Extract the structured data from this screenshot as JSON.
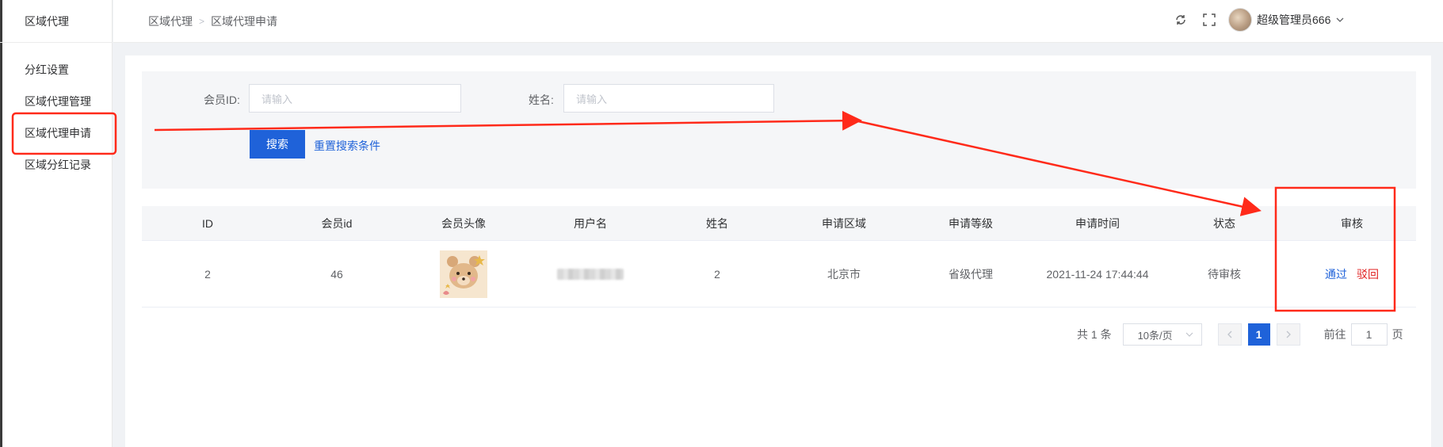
{
  "sidebar": {
    "title": "区域代理",
    "items": [
      {
        "label": "分红设置"
      },
      {
        "label": "区域代理管理"
      },
      {
        "label": "区域代理申请"
      },
      {
        "label": "区域分红记录"
      }
    ]
  },
  "header": {
    "breadcrumb": [
      "区域代理",
      "区域代理申请"
    ],
    "user_name": "超级管理员666"
  },
  "search": {
    "member_id_label": "会员ID:",
    "member_id_placeholder": "请输入",
    "name_label": "姓名:",
    "name_placeholder": "请输入",
    "search_button": "搜索",
    "reset_link": "重置搜索条件"
  },
  "table": {
    "columns": [
      "ID",
      "会员id",
      "会员头像",
      "用户名",
      "姓名",
      "申请区域",
      "申请等级",
      "申请时间",
      "状态",
      "审核"
    ],
    "rows": [
      {
        "id": "2",
        "member_id": "46",
        "name": "2",
        "region": "北京市",
        "level": "省级代理",
        "time": "2021-11-24 17:44:44",
        "status": "待审核",
        "approve": "通过",
        "reject": "驳回"
      }
    ]
  },
  "pagination": {
    "total": "共 1 条",
    "page_size": "10条/页",
    "current_page": "1",
    "goto_label": "前往",
    "goto_value": "1",
    "page_suffix": "页"
  },
  "colors": {
    "primary": "#1f62d9",
    "danger": "#e02020",
    "annotation": "#ff2a1a"
  }
}
